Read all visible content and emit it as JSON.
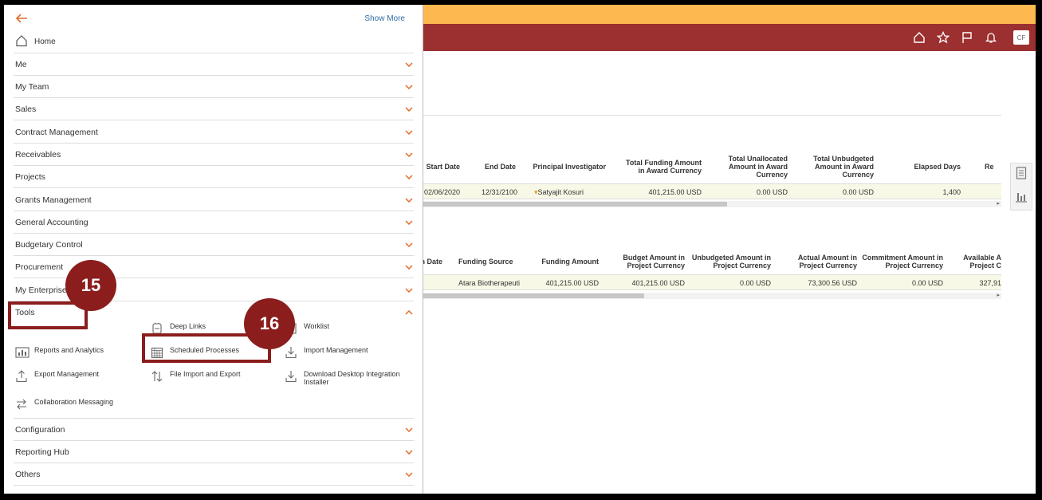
{
  "app": {
    "avatar_initials": "CF",
    "header_icons": [
      "home-icon",
      "star-icon",
      "flag-icon",
      "bell-icon"
    ],
    "accent": "#9c2f2f",
    "strip": "#fdb94f"
  },
  "table1": {
    "headers": [
      "Start Date",
      "End Date",
      "Principal Investigator",
      "Total Funding Amount in Award Currency",
      "Total Unallocated Amount in Award Currency",
      "Total Unbudgeted Amount in Award Currency",
      "Elapsed Days",
      "Re"
    ],
    "row": [
      "02/06/2020",
      "12/31/2100",
      "Satyajit Kosuri",
      "401,215.00 USD",
      "0.00 USD",
      "0.00 USD",
      "1,400",
      ""
    ]
  },
  "table2": {
    "headers": [
      "n Date",
      "Funding Source",
      "Funding Amount",
      "Budget Amount in Project Currency",
      "Unbudgeted Amount in Project Currency",
      "Actual Amount in Project Currency",
      "Commitment Amount in Project Currency",
      "Available A Project C"
    ],
    "row": [
      "",
      "Atara Biotherapeuti",
      "401,215.00 USD",
      "401,215.00 USD",
      "0.00 USD",
      "73,300.56 USD",
      "0.00 USD",
      "327,91"
    ]
  },
  "navigator": {
    "show_more": "Show More",
    "home": "Home",
    "groups": [
      "Me",
      "My Team",
      "Sales",
      "Contract Management",
      "Receivables",
      "Projects",
      "Grants Management",
      "General Accounting",
      "Budgetary Control",
      "Procurement",
      "My Enterprise",
      "Tools"
    ],
    "tools": {
      "deep_links": "Deep Links",
      "worklist": "Worklist",
      "reports": "Reports and Analytics",
      "scheduled": "Scheduled Processes",
      "import_mgmt": "Import Management",
      "export_mgmt": "Export Management",
      "file_import": "File Import and Export",
      "download_desktop": "Download Desktop Integration Installer",
      "collab": "Collaboration Messaging"
    },
    "bottom_groups": [
      "Configuration",
      "Reporting Hub",
      "Others"
    ]
  },
  "callouts": {
    "step15": "15",
    "step16": "16"
  }
}
